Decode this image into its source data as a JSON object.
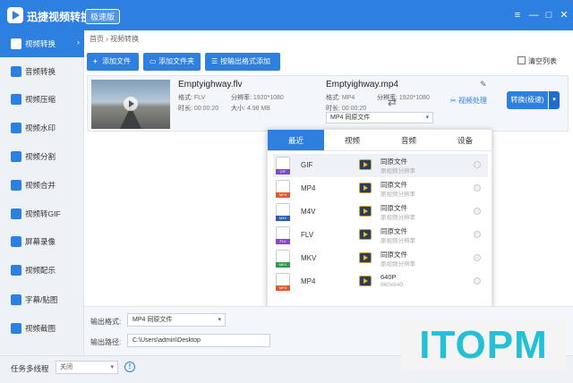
{
  "app": {
    "title": "迅捷视频转换器",
    "badge": "极速版",
    "window_controls": [
      "≡",
      "—",
      "□",
      "✕"
    ]
  },
  "sidebar": {
    "items": [
      {
        "label": "视频转换",
        "icon": "convert-icon",
        "active": true
      },
      {
        "label": "音频转换",
        "icon": "audio-icon"
      },
      {
        "label": "视频压缩",
        "icon": "compress-icon"
      },
      {
        "label": "视频水印",
        "icon": "watermark-icon"
      },
      {
        "label": "视频分割",
        "icon": "split-icon"
      },
      {
        "label": "视频合并",
        "icon": "merge-icon"
      },
      {
        "label": "视频转GIF",
        "icon": "gif-icon"
      },
      {
        "label": "屏幕录像",
        "icon": "record-icon"
      },
      {
        "label": "视频配乐",
        "icon": "music-icon"
      },
      {
        "label": "字幕/贴图",
        "icon": "subtitle-icon"
      },
      {
        "label": "视频截图",
        "icon": "screenshot-icon"
      }
    ],
    "active_arrow": "›"
  },
  "breadcrumb": {
    "home": "首页",
    "sep": "›",
    "current": "视频转换"
  },
  "toolbar": {
    "add_file": "添加文件",
    "add_folder": "添加文件夹",
    "add_by_format": "按输出格式添加",
    "clear_list": "清空列表"
  },
  "task": {
    "src_name": "Emptyighway.flv",
    "src_format_label": "格式:",
    "src_format": "FLV",
    "src_res_label": "分辨率:",
    "src_res": "1920*1080",
    "src_dur_label": "时长:",
    "src_dur": "00:00:20",
    "src_size_label": "大小:",
    "src_size": "4.98 MB",
    "dst_name": "Emptyighway.mp4",
    "dst_format_label": "格式:",
    "dst_format": "MP4",
    "dst_res_label": "分辨率:",
    "dst_res": "1920*1080",
    "dst_dur_label": "时长:",
    "dst_dur": "00:00:20",
    "format_select": "MP4  同原文件",
    "video_process": "视频处理",
    "convert": "转换(极速)",
    "convert_dropdown": "▾"
  },
  "format_popup": {
    "tabs": [
      {
        "label": "最近",
        "active": true
      },
      {
        "label": "视频"
      },
      {
        "label": "音频"
      },
      {
        "label": "设备"
      }
    ],
    "rows": [
      {
        "format": "GIF",
        "strip_color": "#7b4bd8",
        "quality": "同原文件",
        "sub": "原视频分辨率"
      },
      {
        "format": "MP4",
        "strip_color": "#e05a2b",
        "quality": "同原文件",
        "sub": "原视频分辨率"
      },
      {
        "format": "M4V",
        "strip_color": "#2a5ea8",
        "quality": "同原文件",
        "sub": "原视频分辨率"
      },
      {
        "format": "FLV",
        "strip_color": "#8b45c9",
        "quality": "同原文件",
        "sub": "原视频分辨率"
      },
      {
        "format": "MKV",
        "strip_color": "#2e9a4a",
        "quality": "同原文件",
        "sub": "原视频分辨率"
      },
      {
        "format": "MP4",
        "strip_color": "#e05a2b",
        "quality": "640P",
        "sub": "960x640"
      }
    ]
  },
  "output": {
    "format_label": "输出格式:",
    "format_value": "MP4  同原文件",
    "path_label": "输出路径:",
    "path_value": "C:\\Users\\admin\\Desktop"
  },
  "statusbar": {
    "multithread_label": "任务多线程",
    "multithread_value": "关闭",
    "info": "!"
  },
  "watermark": "ITOPM",
  "icons": {
    "plus": "+",
    "shuffle": "⇄",
    "pencil": "✎",
    "caret": "▾",
    "scissors": "✂"
  }
}
